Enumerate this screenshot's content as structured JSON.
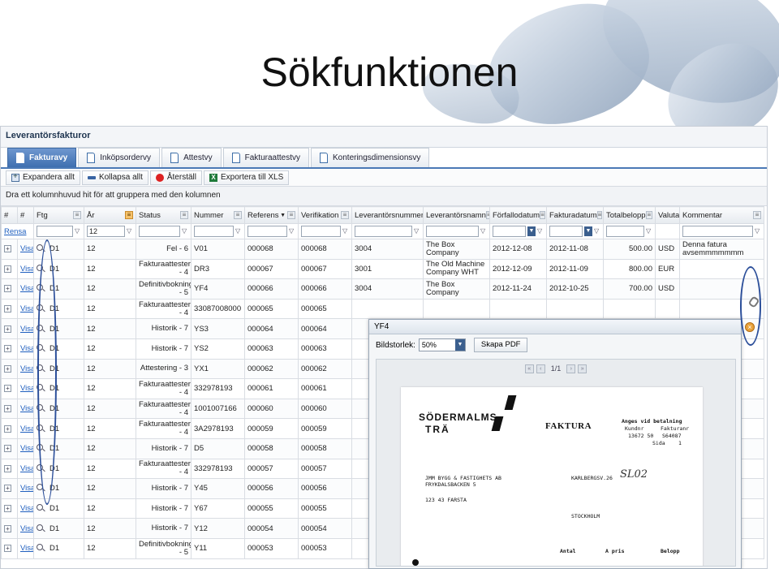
{
  "slide": {
    "title": "Sökfunktionen"
  },
  "app": {
    "header": "Leverantörsfakturor",
    "tabs": [
      {
        "label": "Fakturavy",
        "active": true
      },
      {
        "label": "Inköpsordervy",
        "active": false
      },
      {
        "label": "Attestvy",
        "active": false
      },
      {
        "label": "Fakturaattestvy",
        "active": false
      },
      {
        "label": "Konteringsdimensionsvy",
        "active": false
      }
    ],
    "toolbar": {
      "expand": "Expandera allt",
      "collapse": "Kollapsa allt",
      "reset": "Återställ",
      "export": "Exportera till XLS"
    },
    "group_hint": "Dra ett kolumnhuvud hit för att gruppera med den kolumnen",
    "columns": [
      "#",
      "#",
      "Ftg",
      "År",
      "Status",
      "Nummer",
      "Referens",
      "Verifikation",
      "Leverantörsnummer",
      "Leverantörsnamn",
      "Förfallodatum",
      "Fakturadatum",
      "Totalbelopp",
      "Valuta",
      "Kommentar"
    ],
    "filter": {
      "clear_label": "Rensa",
      "year_value": "12"
    },
    "rows": [
      {
        "visa": "Visa",
        "ftg": "D1",
        "ar": "12",
        "status": "Fel - 6",
        "nummer": "V01",
        "referens": "000068",
        "verifikation": "000068",
        "levnr": "3004",
        "levnamn": "The Box Company",
        "forfallo": "2012-12-08",
        "fakturadatum": "2012-11-08",
        "belopp": "500.00",
        "valuta": "USD",
        "kommentar": "Denna fatura avsemmmmmmm"
      },
      {
        "visa": "Visa",
        "ftg": "D1",
        "ar": "12",
        "status": "Fakturaattestering - 4",
        "nummer": "DR3",
        "referens": "000067",
        "verifikation": "000067",
        "levnr": "3001",
        "levnamn": "The Old Machine Company WHT",
        "forfallo": "2012-12-09",
        "fakturadatum": "2012-11-09",
        "belopp": "800.00",
        "valuta": "EUR",
        "kommentar": ""
      },
      {
        "visa": "Visa",
        "ftg": "D1",
        "ar": "12",
        "status": "Definitivbokning - 5",
        "nummer": "YF4",
        "referens": "000066",
        "verifikation": "000066",
        "levnr": "3004",
        "levnamn": "The Box Company",
        "forfallo": "2012-11-24",
        "fakturadatum": "2012-10-25",
        "belopp": "700.00",
        "valuta": "USD",
        "kommentar": ""
      },
      {
        "visa": "Visa",
        "ftg": "D1",
        "ar": "12",
        "status": "Fakturaattestering - 4",
        "nummer": "33087008000",
        "referens": "000065",
        "verifikation": "000065",
        "levnr": "",
        "levnamn": "",
        "forfallo": "",
        "fakturadatum": "",
        "belopp": "",
        "valuta": "",
        "kommentar": ""
      },
      {
        "visa": "Visa",
        "ftg": "D1",
        "ar": "12",
        "status": "Historik - 7",
        "nummer": "YS3",
        "referens": "000064",
        "verifikation": "000064",
        "levnr": "",
        "levnamn": "",
        "forfallo": "",
        "fakturadatum": "",
        "belopp": "",
        "valuta": "",
        "kommentar": ""
      },
      {
        "visa": "Visa",
        "ftg": "D1",
        "ar": "12",
        "status": "Historik - 7",
        "nummer": "YS2",
        "referens": "000063",
        "verifikation": "000063",
        "levnr": "",
        "levnamn": "",
        "forfallo": "",
        "fakturadatum": "",
        "belopp": "",
        "valuta": "",
        "kommentar": ""
      },
      {
        "visa": "Visa",
        "ftg": "D1",
        "ar": "12",
        "status": "Attestering - 3",
        "nummer": "YX1",
        "referens": "000062",
        "verifikation": "000062",
        "levnr": "",
        "levnamn": "",
        "forfallo": "",
        "fakturadatum": "",
        "belopp": "",
        "valuta": "",
        "kommentar": ""
      },
      {
        "visa": "Visa",
        "ftg": "D1",
        "ar": "12",
        "status": "Fakturaattestering - 4",
        "nummer": "332978193",
        "referens": "000061",
        "verifikation": "000061",
        "levnr": "",
        "levnamn": "",
        "forfallo": "",
        "fakturadatum": "",
        "belopp": "",
        "valuta": "",
        "kommentar": ""
      },
      {
        "visa": "Visa",
        "ftg": "D1",
        "ar": "12",
        "status": "Fakturaattestering - 4",
        "nummer": "1001007166",
        "referens": "000060",
        "verifikation": "000060",
        "levnr": "",
        "levnamn": "",
        "forfallo": "",
        "fakturadatum": "",
        "belopp": "",
        "valuta": "",
        "kommentar": ""
      },
      {
        "visa": "Visa",
        "ftg": "D1",
        "ar": "12",
        "status": "Fakturaattestering - 4",
        "nummer": "3A2978193",
        "referens": "000059",
        "verifikation": "000059",
        "levnr": "",
        "levnamn": "",
        "forfallo": "",
        "fakturadatum": "",
        "belopp": "",
        "valuta": "",
        "kommentar": ""
      },
      {
        "visa": "Visa",
        "ftg": "D1",
        "ar": "12",
        "status": "Historik - 7",
        "nummer": "D5",
        "referens": "000058",
        "verifikation": "000058",
        "levnr": "",
        "levnamn": "",
        "forfallo": "",
        "fakturadatum": "",
        "belopp": "",
        "valuta": "",
        "kommentar": ""
      },
      {
        "visa": "Visa",
        "ftg": "D1",
        "ar": "12",
        "status": "Fakturaattestering - 4",
        "nummer": "332978193",
        "referens": "000057",
        "verifikation": "000057",
        "levnr": "",
        "levnamn": "",
        "forfallo": "",
        "fakturadatum": "",
        "belopp": "",
        "valuta": "",
        "kommentar": ""
      },
      {
        "visa": "Visa",
        "ftg": "D1",
        "ar": "12",
        "status": "Historik - 7",
        "nummer": "Y45",
        "referens": "000056",
        "verifikation": "000056",
        "levnr": "",
        "levnamn": "",
        "forfallo": "",
        "fakturadatum": "",
        "belopp": "",
        "valuta": "",
        "kommentar": ""
      },
      {
        "visa": "Visa",
        "ftg": "D1",
        "ar": "12",
        "status": "Historik - 7",
        "nummer": "Y67",
        "referens": "000055",
        "verifikation": "000055",
        "levnr": "",
        "levnamn": "",
        "forfallo": "",
        "fakturadatum": "",
        "belopp": "",
        "valuta": "",
        "kommentar": ""
      },
      {
        "visa": "Visa",
        "ftg": "D1",
        "ar": "12",
        "status": "Historik - 7",
        "nummer": "Y12",
        "referens": "000054",
        "verifikation": "000054",
        "levnr": "",
        "levnamn": "",
        "forfallo": "",
        "fakturadatum": "",
        "belopp": "",
        "valuta": "",
        "kommentar": ""
      },
      {
        "visa": "Visa",
        "ftg": "D1",
        "ar": "12",
        "status": "Definitivbokning - 5",
        "nummer": "Y11",
        "referens": "000053",
        "verifikation": "000053",
        "levnr": "",
        "levnamn": "",
        "forfallo": "",
        "fakturadatum": "",
        "belopp": "",
        "valuta": "",
        "kommentar": ""
      }
    ]
  },
  "viewer": {
    "title": "YF4",
    "size_label": "Bildstorlek:",
    "zoom": "50%",
    "create_pdf": "Skapa PDF",
    "page_indicator": "1/1",
    "invoice": {
      "logo_line1": "SÖDERMALMS",
      "logo_line2": "TRÄ",
      "title": "FAKTURA",
      "pay_note": "Anges vid betalning",
      "kundnr_label": "Kundnr",
      "fakturanr_label": "Fakturanr",
      "kundnr": "13672 50",
      "fakturanr": "S64087",
      "sida_label": "Sida",
      "sida": "1",
      "recipient_name": "JMM BYGG & FASTIGHETS AB",
      "recipient_street": "FRYKDALSBACKEN 5",
      "recipient_zip": "123 43 FARSTA",
      "delivery_street": "KARLBERGSV.26",
      "delivery_city": "STOCKHOLM",
      "handwritten": "SL02",
      "col_antal": "Antal",
      "col_apris": "A pris",
      "col_belopp": "Belopp"
    }
  },
  "colors": {
    "accent": "#3f6fb0",
    "annotation": "#2c4f9a",
    "link": "#1f5fbf"
  }
}
